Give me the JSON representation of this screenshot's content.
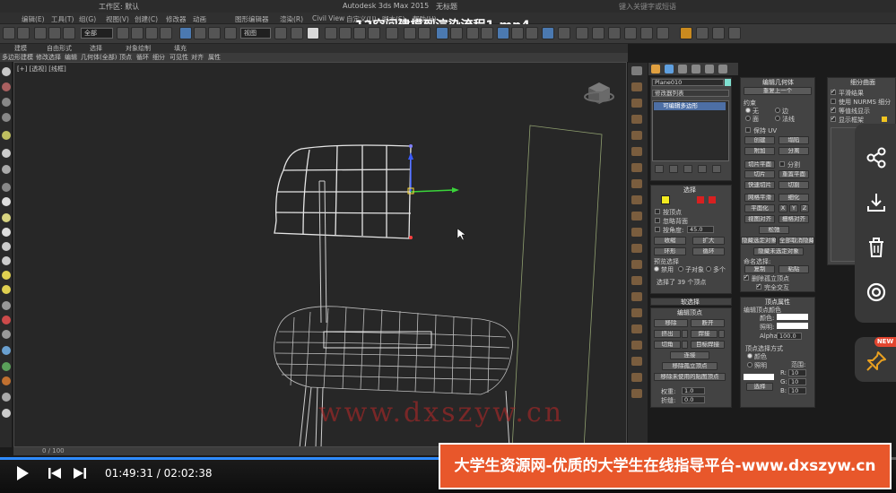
{
  "window": {
    "app_title": "Autodesk 3ds Max 2015",
    "file_name": "无标题",
    "workspace": "工作区: 默认",
    "search_placeholder": "键入关键字或短语"
  },
  "video_title": "12空间建模到渲染流程1.mp4",
  "menu": [
    "编辑(E)",
    "工具(T)",
    "组(G)",
    "视图(V)",
    "创建(C)",
    "修改器",
    "动画",
    "图形编辑器",
    "渲染(R)",
    "Civil View",
    "自定义(U)",
    "脚本(S)",
    "帮助(H)"
  ],
  "toolbar": {
    "selection_filter": "全部",
    "view_dropdown": "视图"
  },
  "ribbon_tabs": [
    "建模",
    "自由形式",
    "选择",
    "对象绘制",
    "填充"
  ],
  "ribbon_sub": [
    "多边形建模",
    "修改选择",
    "编辑",
    "几何体(全部)",
    "顶点",
    "循环",
    "细分",
    "可见性",
    "对齐",
    "属性"
  ],
  "viewport": {
    "label": "[+] [透视] [线框]"
  },
  "command_panel": {
    "object_name": "Plane010",
    "modifier_list": "修改器列表",
    "stack_item": "可编辑多边形",
    "selection": {
      "title": "选择",
      "by_vertex": "按顶点",
      "ignore_backfacing": "忽略背面",
      "by_angle": "按角度:",
      "angle_value": "45.0",
      "shrink": "收缩",
      "grow": "扩大",
      "ring": "环形",
      "loop": "循环",
      "preview_title": "预览选择",
      "preview_off": "禁用",
      "preview_subobj": "子对象",
      "preview_multi": "多个",
      "status": "选择了 39 个顶点"
    },
    "soft_selection": "软选择",
    "edit_vertices": {
      "title": "编辑顶点",
      "remove": "移除",
      "break": "断开",
      "extrude": "挤出",
      "weld": "焊接",
      "chamfer": "切角",
      "target_weld": "目标焊接",
      "connect": "连接",
      "remove_isolated": "移除孤立顶点",
      "remove_unused_map": "移除未使用的贴图顶点",
      "weight_label": "权重:",
      "weight_value": "1.0",
      "crease_label": "折缝:",
      "crease_value": "0.0"
    },
    "edit_geometry": {
      "title": "编辑几何体",
      "repeat_last": "重复上一个",
      "constraints": "约束",
      "none": "无",
      "edge": "边",
      "face": "面",
      "normal": "法线",
      "preserve_uv": "保持 UV",
      "create": "创建",
      "collapse": "塌陷",
      "attach": "附加",
      "detach": "分离",
      "slice_plane": "切片平面",
      "split": "分割",
      "slice": "切片",
      "reset_plane": "重置平面",
      "quickslice": "快速切片",
      "cut": "切割",
      "meshsmooth": "网格平滑",
      "tessellate": "细化",
      "make_planar": "平面化",
      "axis_x": "X",
      "axis_y": "Y",
      "axis_z": "Z",
      "view_align": "视图对齐",
      "grid_align": "栅格对齐",
      "relax": "松弛",
      "hide_selected": "隐藏选定对象",
      "unhide_all": "全部取消隐藏",
      "hide_unselected": "隐藏未选定对象",
      "named_selections": "命名选择:",
      "copy": "复制",
      "paste": "粘贴",
      "delete_isolated": "删除孤立顶点",
      "full_interactivity": "完全交互"
    },
    "vertex_properties": {
      "title": "顶点属性",
      "edit_vertex_colors": "编辑顶点颜色",
      "color": "颜色:",
      "illumination": "照明:",
      "alpha": "Alpha:",
      "alpha_value": "100.0",
      "select_by": "顶点选择方式",
      "by_color": "颜色",
      "by_illum": "照明",
      "range": "范围:",
      "r_label": "R:",
      "g_label": "G:",
      "b_label": "B:",
      "r_value": "10",
      "g_value": "10",
      "b_value": "10",
      "select_btn": "选择"
    },
    "subdivision": {
      "title": "细分曲面",
      "smooth_result": "平滑结果",
      "use_nurms": "使用 NURMS 细分",
      "isoline": "等值线显示",
      "show_cage": "显示框架"
    }
  },
  "watermark": "www.dxszyw.cn",
  "timeline_label": "0 / 100",
  "playback": {
    "current_time": "01:49:31",
    "total_time": "02:02:38",
    "progress": 0.893
  },
  "banner": "大学生资源网-优质的大学生在线指导平台-www.dxszyw.cn",
  "new_badge": "NEW"
}
